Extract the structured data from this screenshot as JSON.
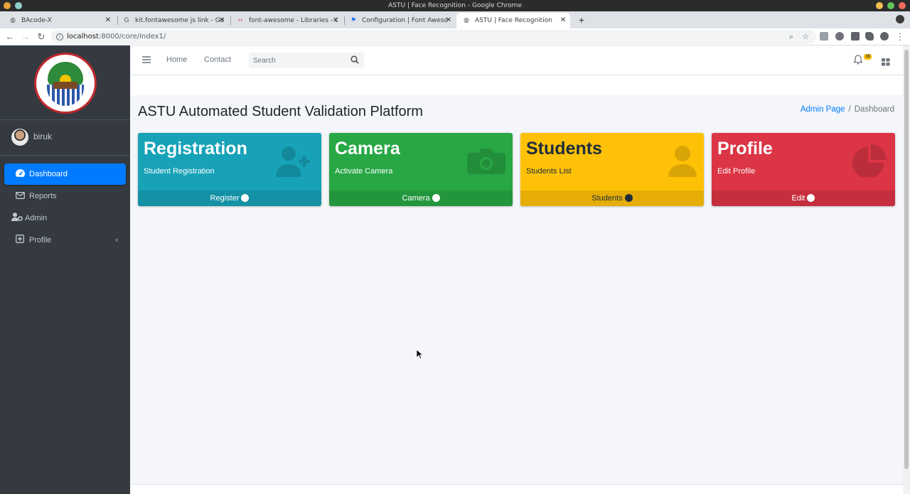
{
  "window": {
    "title": "ASTU | Face Recognition - Google Chrome"
  },
  "tabs": [
    {
      "label": "BAcode-X",
      "icon": "globe-icon"
    },
    {
      "label": "kit.fontawesome js link - Go",
      "icon": "google-icon"
    },
    {
      "label": "font-awesome - Libraries - c",
      "icon": "code-icon"
    },
    {
      "label": "Configuration | Font Aweso",
      "icon": "flag-icon"
    },
    {
      "label": "ASTU | Face Recognition",
      "icon": "globe-icon",
      "active": true
    }
  ],
  "address": {
    "host": "localhost",
    "path": ":8000/core/index1/"
  },
  "sidebar": {
    "user": "biruk",
    "items": [
      {
        "label": "Dashboard",
        "icon": "dashboard-icon",
        "active": true
      },
      {
        "label": "Reports",
        "icon": "envelope-icon"
      },
      {
        "label": "Admin",
        "icon": "user-cog-icon"
      },
      {
        "label": "Profile",
        "icon": "plus-square-icon"
      }
    ]
  },
  "topnav": {
    "links": [
      "Home",
      "Contact"
    ],
    "search_placeholder": "Search",
    "notification_count": "15"
  },
  "page": {
    "title": "ASTU Automated Student Validation Platform",
    "breadcrumb": {
      "link": "Admin Page",
      "current": "Dashboard"
    }
  },
  "cards": [
    {
      "title": "Registration",
      "subtitle": "Student Registration",
      "footer": "Register",
      "color": "#17a2b8",
      "icon": "user-plus-icon"
    },
    {
      "title": "Camera",
      "subtitle": "Activate Camera",
      "footer": "Camera",
      "color": "#28a745",
      "icon": "camera-icon"
    },
    {
      "title": "Students",
      "subtitle": "Students List",
      "footer": "Students",
      "color": "#ffc107",
      "icon": "user-icon"
    },
    {
      "title": "Profile",
      "subtitle": "Edit Profile",
      "footer": "Edit",
      "color": "#dc3545",
      "icon": "pie-chart-icon"
    }
  ]
}
